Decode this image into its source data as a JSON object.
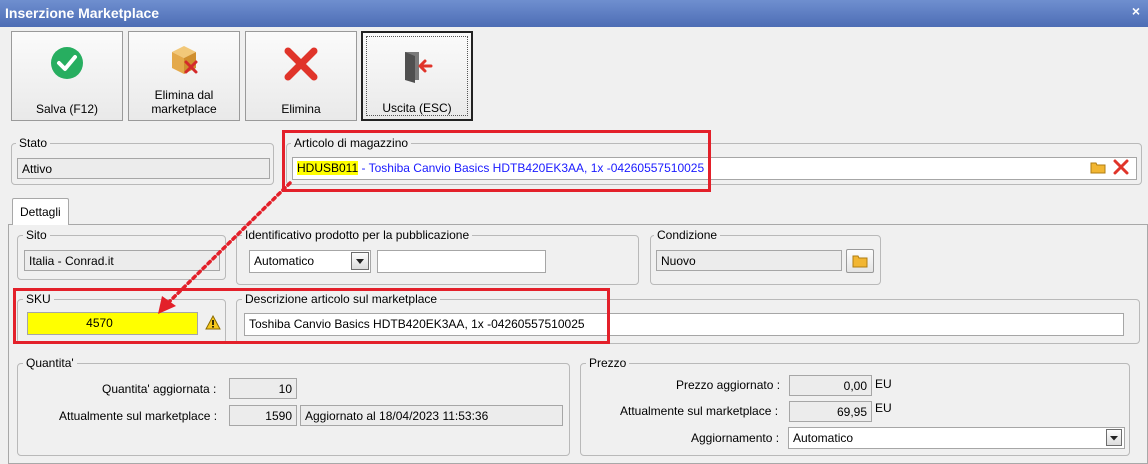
{
  "window": {
    "title": "Inserzione Marketplace",
    "close_glyph": "×"
  },
  "toolbar": {
    "save_label": "Salva (F12)",
    "remove_marketplace_label": "Elimina dal marketplace",
    "delete_label": "Elimina",
    "exit_label": "Uscita (ESC)"
  },
  "stato": {
    "legend": "Stato",
    "value": "Attivo"
  },
  "articolo": {
    "legend": "Articolo di magazzino",
    "code": "HDUSB011",
    "separator": " - ",
    "description": "Toshiba Canvio Basics HDTB420EK3AA, 1x -04260557510025"
  },
  "tabs": [
    {
      "label": "Dettagli"
    }
  ],
  "sito": {
    "legend": "Sito",
    "value": "Italia - Conrad.it"
  },
  "identificativo": {
    "legend": "Identificativo prodotto per la pubblicazione",
    "selected": "Automatico",
    "value": ""
  },
  "condizione": {
    "legend": "Condizione",
    "value": "Nuovo"
  },
  "sku": {
    "legend": "SKU",
    "value": "4570"
  },
  "descrizione": {
    "legend": "Descrizione articolo sul marketplace",
    "value": "Toshiba Canvio Basics HDTB420EK3AA, 1x -04260557510025"
  },
  "quantita": {
    "legend": "Quantita'",
    "updated_label": "Quantita' aggiornata :",
    "updated_value": "10",
    "current_label": "Attualmente sul marketplace :",
    "current_value": "1590",
    "updated_note": "Aggiornato al 18/04/2023 11:53:36"
  },
  "prezzo": {
    "legend": "Prezzo",
    "updated_label": "Prezzo aggiornato :",
    "updated_value": "0,00",
    "current_label": "Attualmente sul marketplace :",
    "current_value": "69,95",
    "currency": "EU",
    "update_label": "Aggiornamento :",
    "update_selected": "Automatico"
  },
  "colors": {
    "title_bar": "#5a7bc2",
    "highlight": "#ffff00",
    "annotation_red": "#e3202a",
    "link_blue": "#1a1aff",
    "ok_green": "#27ae60"
  }
}
